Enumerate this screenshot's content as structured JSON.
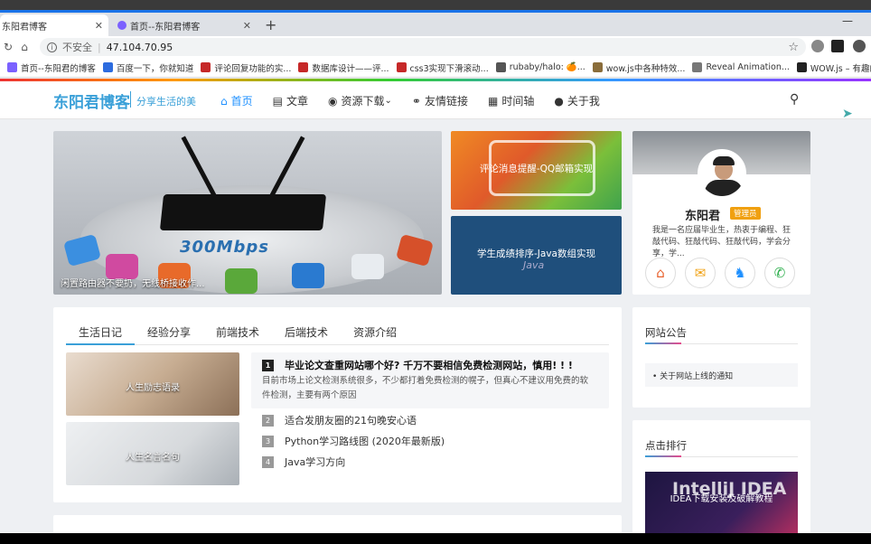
{
  "browser": {
    "tabs": [
      {
        "title": "东阳君博客",
        "active": true
      },
      {
        "title": "首页--东阳君博客",
        "active": false
      }
    ],
    "new_tab_icon": "plus-icon",
    "address": {
      "security_label": "不安全",
      "url": "47.104.70.95"
    },
    "bookmarks": [
      {
        "label": "首页--东阳君的博客",
        "color": "#7b61ff"
      },
      {
        "label": "百度一下，你就知道",
        "color": "#2d6cdf"
      },
      {
        "label": "评论回复功能的实...",
        "color": "#c62828"
      },
      {
        "label": "数据库设计——评...",
        "color": "#c62828"
      },
      {
        "label": "css3实现下滑滚动...",
        "color": "#c62828"
      },
      {
        "label": "rubaby/halo: 🍊...",
        "color": "#555555"
      },
      {
        "label": "wow.js中各种特效...",
        "color": "#8a6d3b"
      },
      {
        "label": "Reveal Animation...",
        "color": "#777777"
      },
      {
        "label": "WOW.js – 有趣的...",
        "color": "#222222"
      }
    ]
  },
  "site": {
    "logo": "东阳君博客",
    "slogan": "分享生活的美",
    "nav": [
      {
        "label": "首页",
        "icon": "home-icon",
        "glyph": "⌂",
        "active": true
      },
      {
        "label": "文章",
        "icon": "document-icon",
        "glyph": "▤",
        "active": false
      },
      {
        "label": "资源下载",
        "icon": "globe-icon",
        "glyph": "◉",
        "active": false
      },
      {
        "label": "友情链接",
        "icon": "link-icon",
        "glyph": "⚭",
        "active": false
      },
      {
        "label": "时间轴",
        "icon": "calendar-icon",
        "glyph": "▦",
        "active": false
      },
      {
        "label": "关于我",
        "icon": "user-icon",
        "glyph": "●",
        "active": false
      }
    ]
  },
  "carousel": {
    "caption": "闲置路由器不要扔，无线桥接收作...",
    "badge": "300Mbps"
  },
  "promos": [
    {
      "caption": "评论消息提醒-QQ邮箱实现"
    },
    {
      "caption": "学生成绩排序-Java数组实现",
      "watermark": "Java"
    }
  ],
  "profile": {
    "name": "东阳君",
    "role": "管理员",
    "description": "我是一名应届毕业生，热衷于编程、狂敲代码、狂敲代码、狂敲代码，学会分享，学...",
    "social": [
      {
        "icon": "home-icon",
        "glyph": "⌂",
        "color": "#e8612c"
      },
      {
        "icon": "mail-icon",
        "glyph": "✉",
        "color": "#f0a010"
      },
      {
        "icon": "qq-icon",
        "glyph": "♞",
        "color": "#1e90ff"
      },
      {
        "icon": "wechat-icon",
        "glyph": "✆",
        "color": "#2aae4a"
      }
    ]
  },
  "article_tabs": {
    "tabs": [
      "生活日记",
      "经验分享",
      "前端技术",
      "后端技术",
      "资源介绍"
    ],
    "thumbs": [
      {
        "caption": "人生励志语录"
      },
      {
        "caption": "人生名言名句"
      }
    ],
    "featured": {
      "rank": "1",
      "title": "毕业论文查重网站哪个好? 千万不要相信免费检测网站，慎用! ! !",
      "desc": "目前市场上论文检测系统很多，不少都打着免费检测的幌子，但真心不建议用免费的软件检测，主要有两个原因"
    },
    "list": [
      {
        "rank": "2",
        "title": "适合发朋友圈的21句晚安心语"
      },
      {
        "rank": "3",
        "title": "Python学习路线图 (2020年最新版)"
      },
      {
        "rank": "4",
        "title": "Java学习方向"
      }
    ]
  },
  "widgets": {
    "notice": {
      "title": "网站公告",
      "items": [
        "关于网站上线的通知"
      ]
    },
    "hot": {
      "title": "点击排行",
      "image_text": "IntelliJ IDEA",
      "caption": "IDEA下载安装及破解教程"
    }
  }
}
